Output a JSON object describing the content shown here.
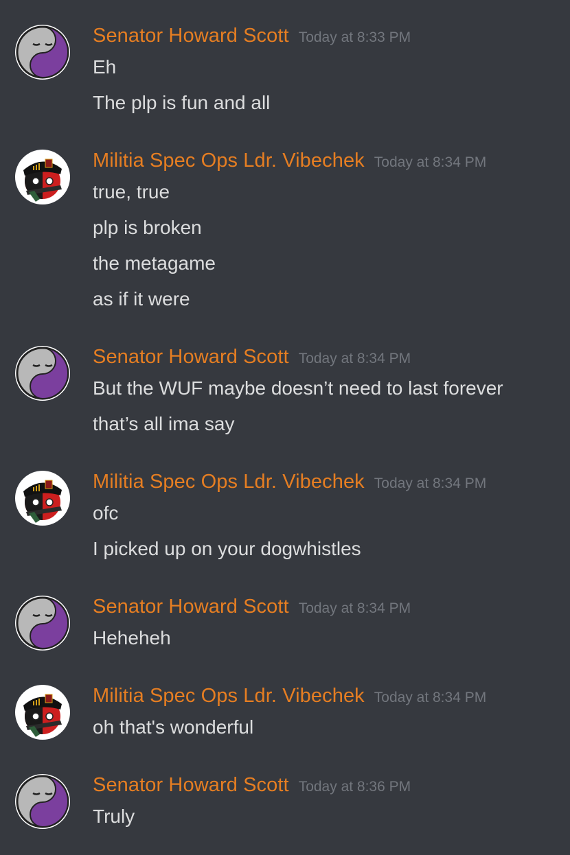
{
  "theme": {
    "background": "#36393f",
    "author_color": "#e67e22",
    "timestamp_color": "#72767d",
    "text_color": "#dcddde"
  },
  "messages": [
    {
      "author": "Senator Howard Scott",
      "avatar": "purple-ball-avatar",
      "timestamp": "Today at 8:33 PM",
      "lines": [
        "Eh",
        "The plp is fun and all"
      ]
    },
    {
      "author": "Militia Spec Ops Ldr. Vibechek",
      "avatar": "soldier-ball-avatar",
      "timestamp": "Today at 8:34 PM",
      "lines": [
        "true, true",
        "plp is broken",
        "the metagame",
        "as if it were"
      ]
    },
    {
      "author": "Senator Howard Scott",
      "avatar": "purple-ball-avatar",
      "timestamp": "Today at 8:34 PM",
      "lines": [
        "But the WUF maybe doesn’t need to last forever",
        "that’s all ima say"
      ]
    },
    {
      "author": "Militia Spec Ops Ldr. Vibechek",
      "avatar": "soldier-ball-avatar",
      "timestamp": "Today at 8:34 PM",
      "lines": [
        "ofc",
        "I picked up on your dogwhistles"
      ]
    },
    {
      "author": "Senator Howard Scott",
      "avatar": "purple-ball-avatar",
      "timestamp": "Today at 8:34 PM",
      "lines": [
        "Heheheh"
      ]
    },
    {
      "author": "Militia Spec Ops Ldr. Vibechek",
      "avatar": "soldier-ball-avatar",
      "timestamp": "Today at 8:34 PM",
      "lines": [
        "oh that's wonderful"
      ]
    },
    {
      "author": "Senator Howard Scott",
      "avatar": "purple-ball-avatar",
      "timestamp": "Today at 8:36 PM",
      "lines": [
        "Truly"
      ]
    }
  ]
}
